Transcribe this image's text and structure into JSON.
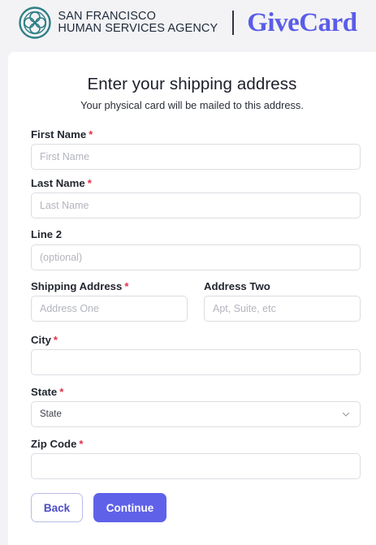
{
  "header": {
    "agency_line1": "SAN FRANCISCO",
    "agency_line2": "HUMAN SERVICES AGENCY",
    "brand_name": "GiveCard",
    "brand_color": "#5a5ce8",
    "seal_icon": "sf-seal-icon"
  },
  "form": {
    "title": "Enter your shipping address",
    "subtitle": "Your physical card will be mailed to this address.",
    "required_marker": "*",
    "first_name": {
      "label": "First Name",
      "placeholder": "First Name",
      "value": ""
    },
    "last_name": {
      "label": "Last Name",
      "placeholder": "Last Name",
      "value": ""
    },
    "line2": {
      "label": "Line 2",
      "placeholder": "(optional)",
      "value": ""
    },
    "shipping_address": {
      "label": "Shipping Address",
      "placeholder": "Address One",
      "value": ""
    },
    "address_two": {
      "label": "Address Two",
      "placeholder": "Apt, Suite, etc",
      "value": ""
    },
    "city": {
      "label": "City",
      "placeholder": "",
      "value": ""
    },
    "state": {
      "label": "State",
      "selected": "State",
      "icon": "chevron-down-icon"
    },
    "zip": {
      "label": "Zip Code",
      "placeholder": "",
      "value": ""
    }
  },
  "buttons": {
    "back": "Back",
    "continue": "Continue",
    "accent": "#5f61e9"
  },
  "colors": {
    "required": "#e0314b",
    "page_bg": "#f3f3f5"
  }
}
